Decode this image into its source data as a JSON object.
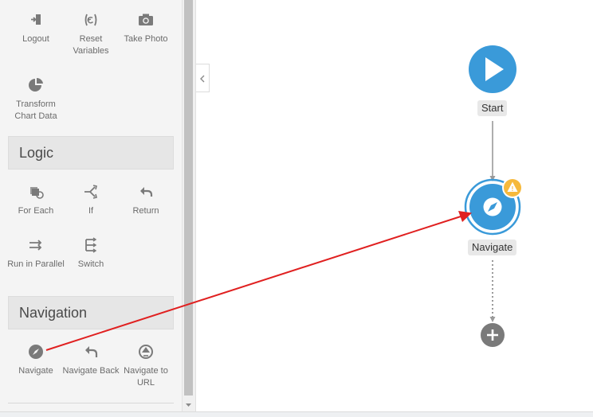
{
  "toolbox": {
    "top_items": [
      {
        "label": "Logout",
        "icon": "logout-icon"
      },
      {
        "label": "Reset Variables",
        "icon": "reset-variables-icon"
      },
      {
        "label": "Take Photo",
        "icon": "camera-icon"
      },
      {
        "label": "Transform Chart Data",
        "icon": "pie-chart-icon"
      }
    ],
    "logic": {
      "title": "Logic",
      "items": [
        {
          "label": "For Each",
          "icon": "for-each-icon"
        },
        {
          "label": "If",
          "icon": "if-icon"
        },
        {
          "label": "Return",
          "icon": "return-icon"
        },
        {
          "label": "Run in Parallel",
          "icon": "run-in-parallel-icon"
        },
        {
          "label": "Switch",
          "icon": "switch-icon"
        }
      ]
    },
    "navigation": {
      "title": "Navigation",
      "items": [
        {
          "label": "Navigate",
          "icon": "navigate-compass-icon"
        },
        {
          "label": "Navigate Back",
          "icon": "navigate-back-icon"
        },
        {
          "label": "Navigate to URL",
          "icon": "navigate-url-icon"
        }
      ]
    }
  },
  "flow": {
    "start_label": "Start",
    "navigate_label": "Navigate",
    "warning": "!"
  },
  "colors": {
    "node_blue": "#3a9ad9",
    "warning_orange": "#f6b93b",
    "annotation_red": "#e02020",
    "icon_gray": "#7a7a7a"
  }
}
